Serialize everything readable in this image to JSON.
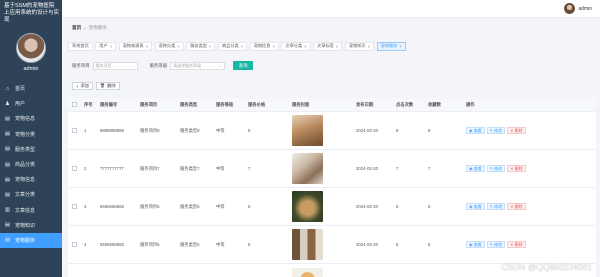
{
  "app": {
    "system_title": "基于SSM的宠物医院上应用系统的设计与实现",
    "admin_name": "admin"
  },
  "topbar": {
    "user_name": "admin"
  },
  "breadcrumb": {
    "home": "首页",
    "current": "宠物服务"
  },
  "sidebar": {
    "items": [
      {
        "label": "首页",
        "icon": "home-icon"
      },
      {
        "label": "用户",
        "icon": "user-icon"
      },
      {
        "label": "宠物信息",
        "icon": "list-icon"
      },
      {
        "label": "宠物分类",
        "icon": "list-icon"
      },
      {
        "label": "服务类型",
        "icon": "list-icon"
      },
      {
        "label": "商品分类",
        "icon": "list-icon"
      },
      {
        "label": "宠物信息",
        "icon": "list-icon"
      },
      {
        "label": "文章分类",
        "icon": "list-icon"
      },
      {
        "label": "文章信息",
        "icon": "chart-icon"
      },
      {
        "label": "宠物知识",
        "icon": "list-icon"
      },
      {
        "label": "宠物服务",
        "icon": "list-icon"
      }
    ]
  },
  "tabs": [
    {
      "label": "系统首页"
    },
    {
      "label": "用户"
    },
    {
      "label": "宠物来源表"
    },
    {
      "label": "宠物分类"
    },
    {
      "label": "服务类型"
    },
    {
      "label": "商品分类"
    },
    {
      "label": "宠物信息"
    },
    {
      "label": "文章分类"
    },
    {
      "label": "文章标签"
    },
    {
      "label": "宠物知识"
    },
    {
      "label": "宠物服务"
    }
  ],
  "search": {
    "label1": "服务项目",
    "placeholder1": "服务项目",
    "label2": "服务等级",
    "placeholder2": "请选择服务等级",
    "button": "查询"
  },
  "actions": {
    "add": "添加",
    "delete": "删除"
  },
  "table": {
    "headers": [
      "序号",
      "服务编号",
      "服务项目",
      "服务类型",
      "服务等级",
      "服务价格",
      "服务封面",
      "发布日期",
      "点击次数",
      "收藏数",
      "操作"
    ],
    "rows": [
      {
        "index": "1",
        "code": "8888888888",
        "name": "服务项目8",
        "type": "服务类型8",
        "level": "中等",
        "price": "8",
        "date": "2024-02-20",
        "clicks": "8",
        "stock": "8"
      },
      {
        "index": "2",
        "code": "7777777777",
        "name": "服务项目7",
        "type": "服务类型7",
        "level": "中等",
        "price": "7",
        "date": "2024-02-20",
        "clicks": "7",
        "stock": "7"
      },
      {
        "index": "3",
        "code": "6666666666",
        "name": "服务项目6",
        "type": "服务类型6",
        "level": "中等",
        "price": "6",
        "date": "2024-02-20",
        "clicks": "6",
        "stock": "6"
      },
      {
        "index": "4",
        "code": "5555555555",
        "name": "服务项目5",
        "type": "服务类型5",
        "level": "中等",
        "price": "5",
        "date": "2024-02-20",
        "clicks": "5",
        "stock": "5"
      }
    ],
    "op_view": "查看",
    "op_edit": "修改",
    "op_delete": "删除"
  },
  "watermark": "CSDN @QQ860234001"
}
